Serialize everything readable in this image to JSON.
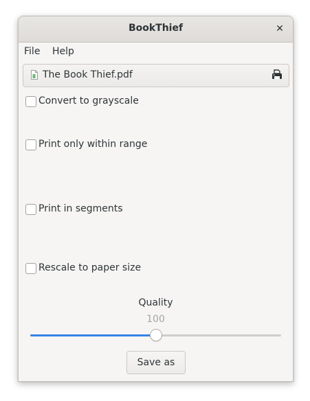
{
  "window": {
    "title": "BookThief",
    "close_glyph": "✕"
  },
  "menubar": {
    "items": [
      {
        "label": "File"
      },
      {
        "label": "Help"
      }
    ]
  },
  "file_chooser": {
    "file_name": "The Book Thief.pdf",
    "file_icon": "document-icon",
    "action_icon": "printer-icon"
  },
  "options": [
    {
      "label": "Convert to grayscale",
      "checked": false
    },
    {
      "label": "Print only within range",
      "checked": false
    },
    {
      "label": "Print in segments",
      "checked": false
    },
    {
      "label": "Rescale to paper size",
      "checked": false
    }
  ],
  "quality": {
    "label": "Quality",
    "value": "100",
    "fraction": 0.5
  },
  "save_button": {
    "label": "Save as"
  },
  "colors": {
    "accent": "#3584e4",
    "window_bg": "#f6f5f4",
    "text": "#2e3436",
    "muted_text": "#a4a6a4"
  }
}
